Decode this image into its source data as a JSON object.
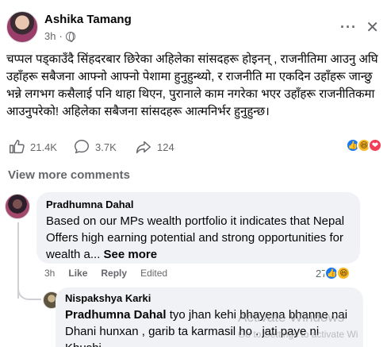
{
  "post": {
    "author": "Ashika Tamang",
    "time": "3h",
    "more_icon": "ellipsis-icon",
    "close_icon": "close-icon",
    "text": "चप्पल पड्काउँदै सिंहदरबार छिरेका अहिलेका सांसदहरू होइनन् , राजनीतिमा आउनु अघि उहाँहरू सबैजना आफ्नो आफ्नो पेशामा हुनुहुन्थ्यो, र राजनीति मा एकदिन उहाँहरू जान्छु भन्ने लगभग कसैलाई पनि थाहा थिएन, पुरानाले काम नगरेका भएर उहाँहरू राजनीतिकमा आउनुपरेको! अहिलेका सबैजना सांसदहरू आत्मनिर्भर हुनुहुन्छ।",
    "likes": "21.4K",
    "comments": "3.7K",
    "shares": "124",
    "reactions": [
      "like-reaction",
      "haha-reaction",
      "love-reaction"
    ]
  },
  "view_more": "View more comments",
  "comment1": {
    "author": "Pradhumna Dahal",
    "text": "Based on our MPs wealth portfolio it indicates that Nepal Offers high earning potential and strong opportunities for wealth a...",
    "see_more": "See more",
    "time": "3h",
    "like": "Like",
    "reply": "Reply",
    "edited": "Edited",
    "reaction_count": "27"
  },
  "comment2": {
    "author": "Nispakshya Karki",
    "mention": "Pradhumna Dahal",
    "text": "tyo jhan kehi bhayena bhanne nai Dhani hunxan , garib ta karmasil ho . jati paye ni Khushi"
  },
  "watermark": {
    "title": "Activate Windows",
    "subtitle": "Go to Settings to activate Wi"
  }
}
